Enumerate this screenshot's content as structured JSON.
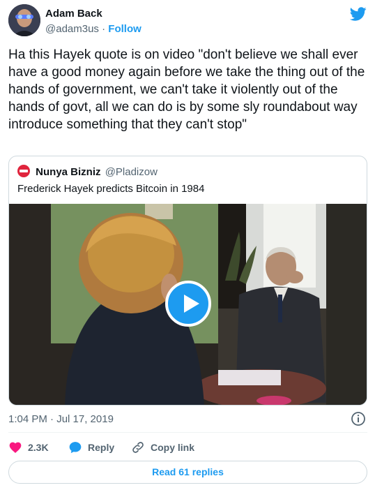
{
  "author": {
    "name": "Adam Back",
    "handle": "@adam3us",
    "separator": "·",
    "follow_label": "Follow"
  },
  "tweet": {
    "text": "Ha this Hayek quote is on video \"don't believe we shall ever have a good money again before we take the thing out of the hands of government, we can't take it violently out of the hands of govt, all we can do is by some sly roundabout way introduce something that they can't stop\"",
    "timestamp": "1:04 PM · Jul 17, 2019"
  },
  "quoted": {
    "name": "Nunya Bizniz",
    "handle": "@Pladizow",
    "text": "Frederick Hayek predicts Bitcoin in 1984"
  },
  "actions": {
    "like_count": "2.3K",
    "reply_label": "Reply",
    "copy_link_label": "Copy link",
    "read_replies_label": "Read 61 replies"
  },
  "colors": {
    "brand_blue": "#1d9bf0",
    "like_red": "#f91880",
    "text_secondary": "#536471",
    "border": "#cfd9de"
  },
  "icons": {
    "platform": "twitter-bird-icon",
    "quoted_avatar": "no-entry-icon",
    "video_play": "play-icon",
    "info": "info-icon",
    "like": "heart-icon",
    "reply": "speech-bubble-icon",
    "copy_link": "link-icon"
  }
}
